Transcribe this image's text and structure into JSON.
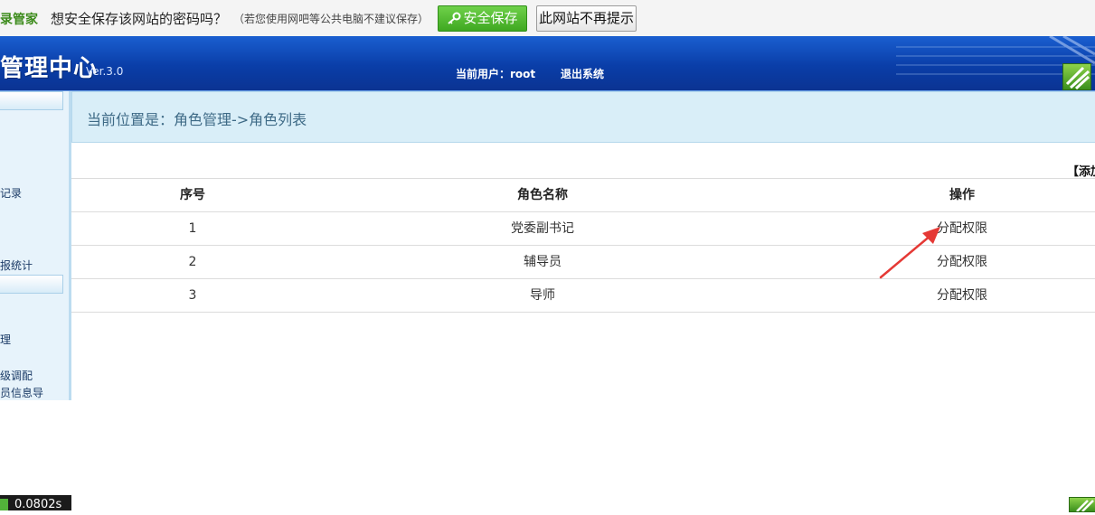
{
  "password_bar": {
    "brand": "录管家",
    "question": "想安全保存该网站的密码吗？",
    "hint": "（若您使用网吧等公共电脑不建议保存）",
    "save_label": "安全保存",
    "never_label": "此网站不再提示"
  },
  "header": {
    "title": "管理中心",
    "version": "Ver.3.0",
    "current_user": "当前用户：root",
    "logout": "退出系统"
  },
  "sidebar": {
    "items": [
      {
        "label": "记录"
      },
      {
        "label": "报统计"
      },
      {
        "label": "理"
      },
      {
        "label": "级调配"
      },
      {
        "label": "员信息导"
      }
    ]
  },
  "location": {
    "text": "当前位置是：角色管理->角色列表"
  },
  "add_link": "【添加",
  "table": {
    "headers": [
      "序号",
      "角色名称",
      "操作"
    ],
    "rows": [
      {
        "index": "1",
        "name": "党委副书记",
        "action": "分配权限"
      },
      {
        "index": "2",
        "name": "辅导员",
        "action": "分配权限"
      },
      {
        "index": "3",
        "name": "导师",
        "action": "分配权限"
      }
    ]
  },
  "footer": {
    "time": "0.0802s"
  },
  "colors": {
    "header_blue": "#0a3ea8",
    "save_green": "#3fa821",
    "location_bg": "#d9eef8",
    "arrow_red": "#e53935"
  }
}
